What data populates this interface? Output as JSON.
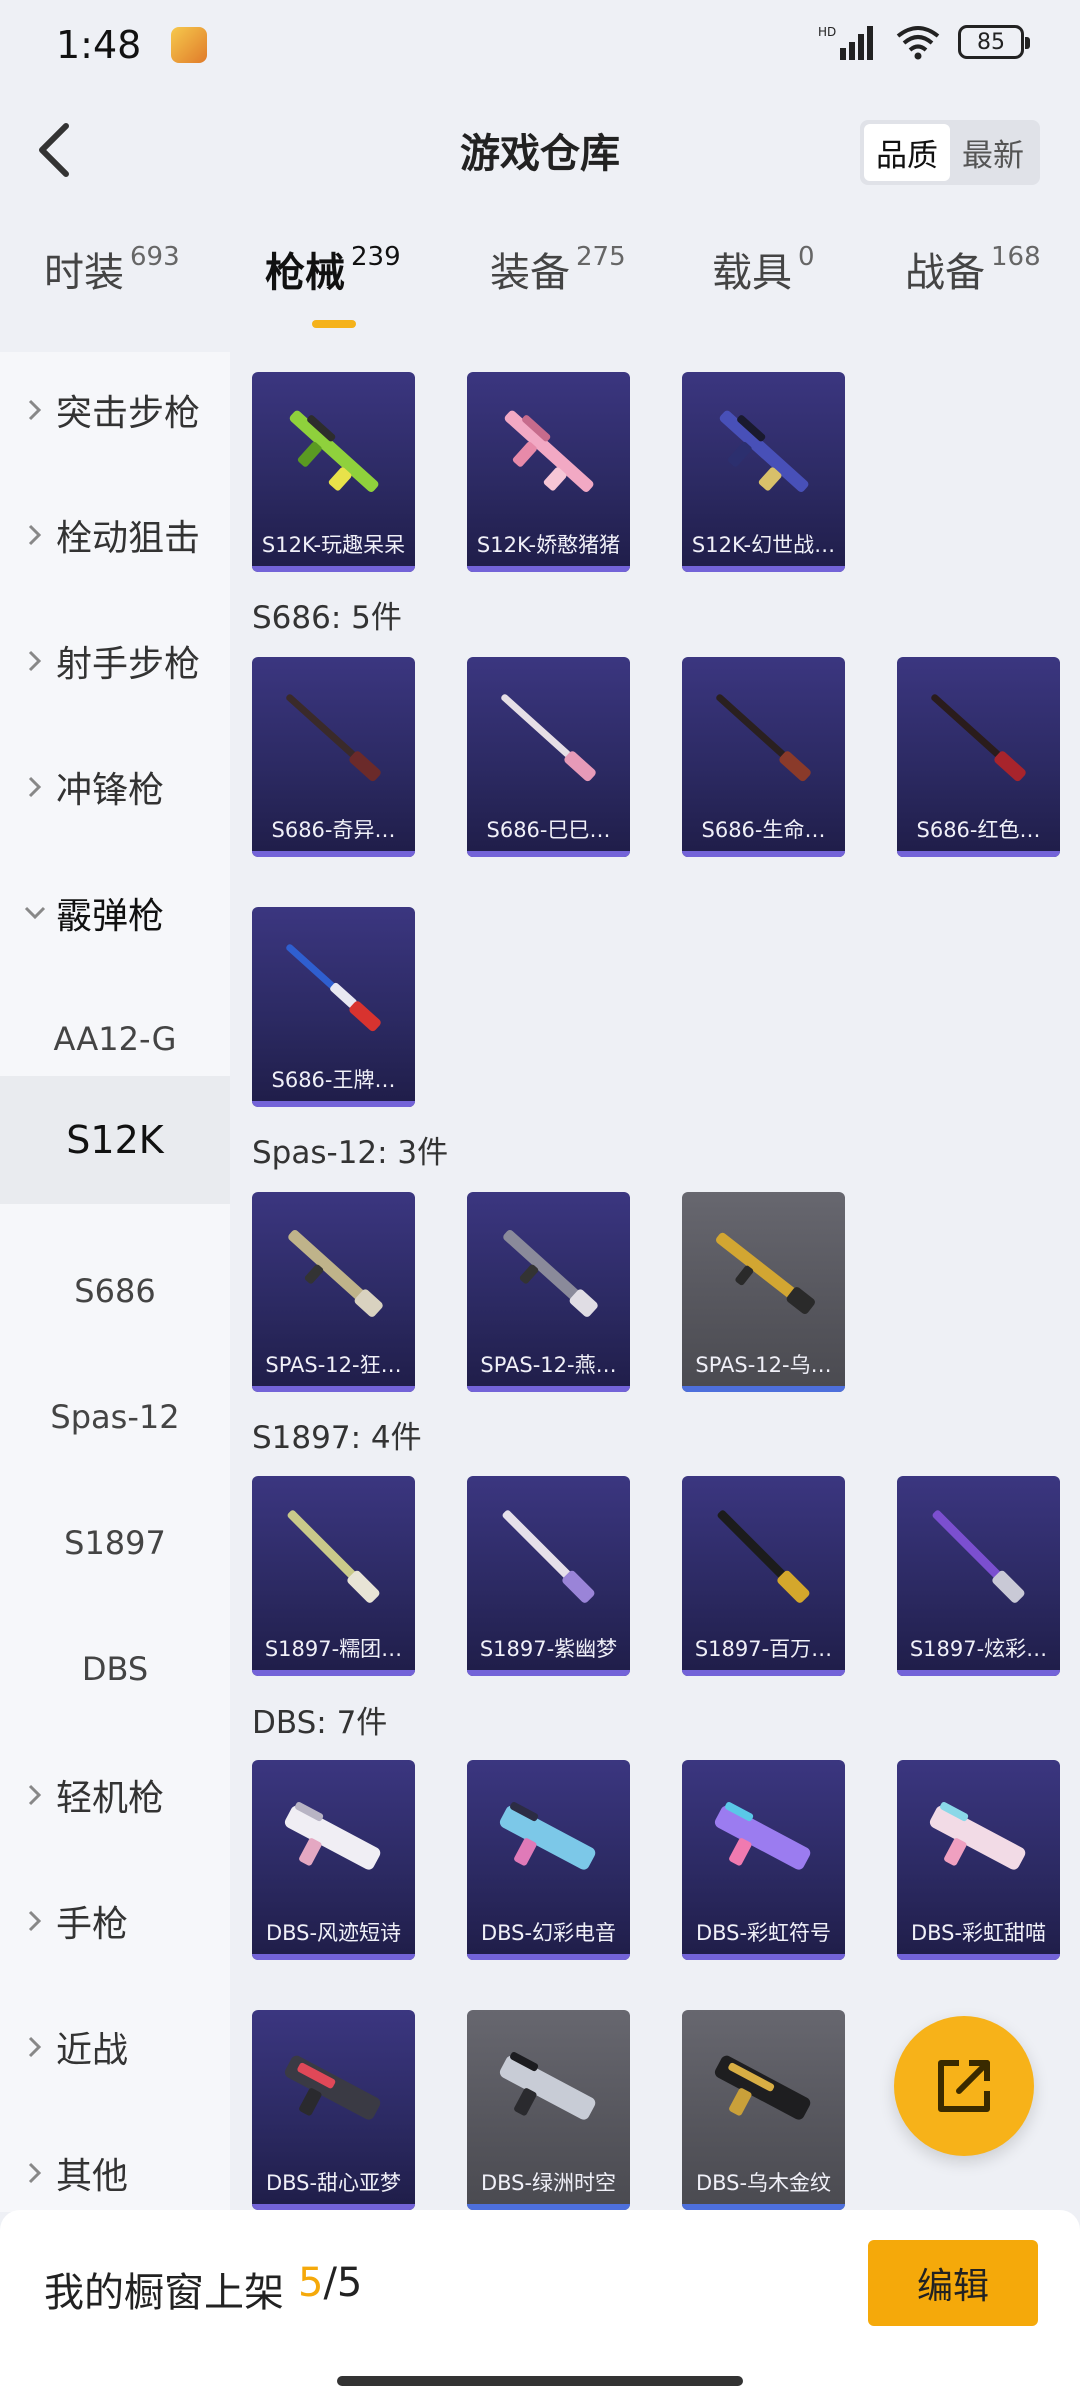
{
  "status": {
    "time": "1:48",
    "battery": "85",
    "icons": [
      "app-icon",
      "signal-icon",
      "wifi-icon",
      "battery-icon"
    ]
  },
  "header": {
    "title": "游戏仓库",
    "sort_quality": "品质",
    "sort_latest": "最新",
    "back_icon": "back-chevron-icon"
  },
  "tabs": [
    {
      "label": "时装",
      "count": "693"
    },
    {
      "label": "枪械",
      "count": "239"
    },
    {
      "label": "装备",
      "count": "275"
    },
    {
      "label": "载具",
      "count": "0"
    },
    {
      "label": "战备",
      "count": "168"
    }
  ],
  "active_tab": "枪械",
  "sidebar": {
    "categories": [
      "突击步枪",
      "栓动狙击",
      "射手步枪",
      "冲锋枪",
      "霰弹枪",
      "轻机枪",
      "手枪",
      "近战",
      "其他"
    ],
    "shotgun_subs": [
      "AA12-G",
      "S12K",
      "S686",
      "Spas-12",
      "S1897",
      "DBS"
    ],
    "selected_sub": "S12K"
  },
  "groups": {
    "s686_title": "S686: 5件",
    "spas_title": "Spas-12: 3件",
    "s1897_title": "S1897: 4件",
    "dbs_title": "DBS: 7件"
  },
  "items": {
    "s12k": [
      "S12K-玩趣呆呆",
      "S12K-娇憨猪猪",
      "S12K-幻世战…"
    ],
    "s686": [
      "S686-奇异…",
      "S686-巳巳…",
      "S686-生命…",
      "S686-红色…",
      "S686-王牌…"
    ],
    "spas": [
      "SPAS-12-狂…",
      "SPAS-12-燕…",
      "SPAS-12-乌…"
    ],
    "s1897": [
      "S1897-糯团…",
      "S1897-紫幽梦",
      "S1897-百万…",
      "S1897-炫彩…"
    ],
    "dbs": [
      "DBS-风迹短诗",
      "DBS-幻彩电音",
      "DBS-彩虹符号",
      "DBS-彩虹甜喵",
      "DBS-甜心亚梦",
      "DBS-绿洲时空",
      "DBS-乌木金纹"
    ]
  },
  "colors": {
    "accent": "#f5a90a",
    "card_purple": "#2c2a63",
    "card_grey": "#55555c"
  },
  "bottom": {
    "showcase_label": "我的橱窗上架",
    "showcase_count": "5",
    "showcase_total": "/5",
    "edit_label": "编辑"
  }
}
